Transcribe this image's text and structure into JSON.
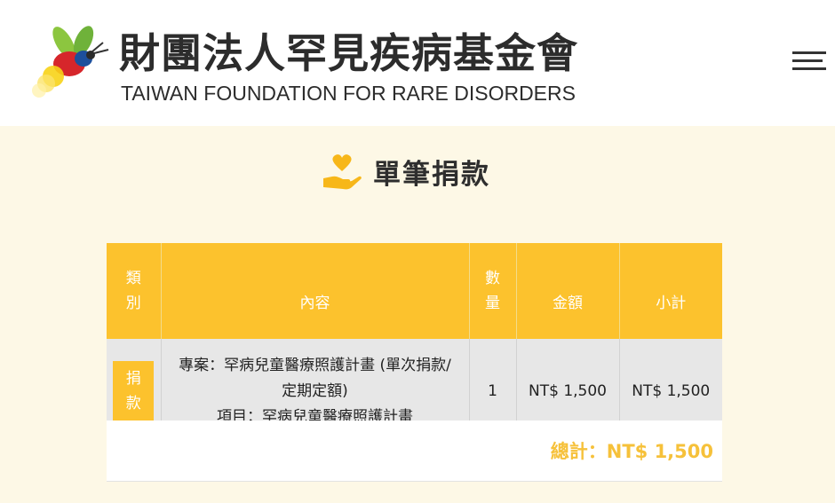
{
  "header": {
    "org_name_zh": "財團法人罕見疾病基金會",
    "org_name_en": "TAIWAN FOUNDATION FOR RARE DISORDERS",
    "logo_icon": "firefly-logo-icon",
    "menu_icon": "hamburger-menu-icon"
  },
  "page": {
    "title": "單筆捐款",
    "title_icon": "heart-hand-icon"
  },
  "table": {
    "headers": {
      "type": "類別",
      "content": "內容",
      "quantity": "數量",
      "amount": "金額",
      "subtotal": "小計"
    },
    "rows": [
      {
        "type": "捐款",
        "content_line1": "專案：罕病兒童醫療照護計畫 (單次捐款/定期定額)",
        "content_line2": "項目：罕病兒童醫療照護計畫",
        "quantity": "1",
        "amount": "NT$ 1,500",
        "subtotal": "NT$ 1,500"
      }
    ],
    "total": "總計：NT$ 1,500"
  },
  "colors": {
    "accent": "#fcc22d",
    "total_text": "#f6c13a",
    "background": "#fdf8e6"
  }
}
